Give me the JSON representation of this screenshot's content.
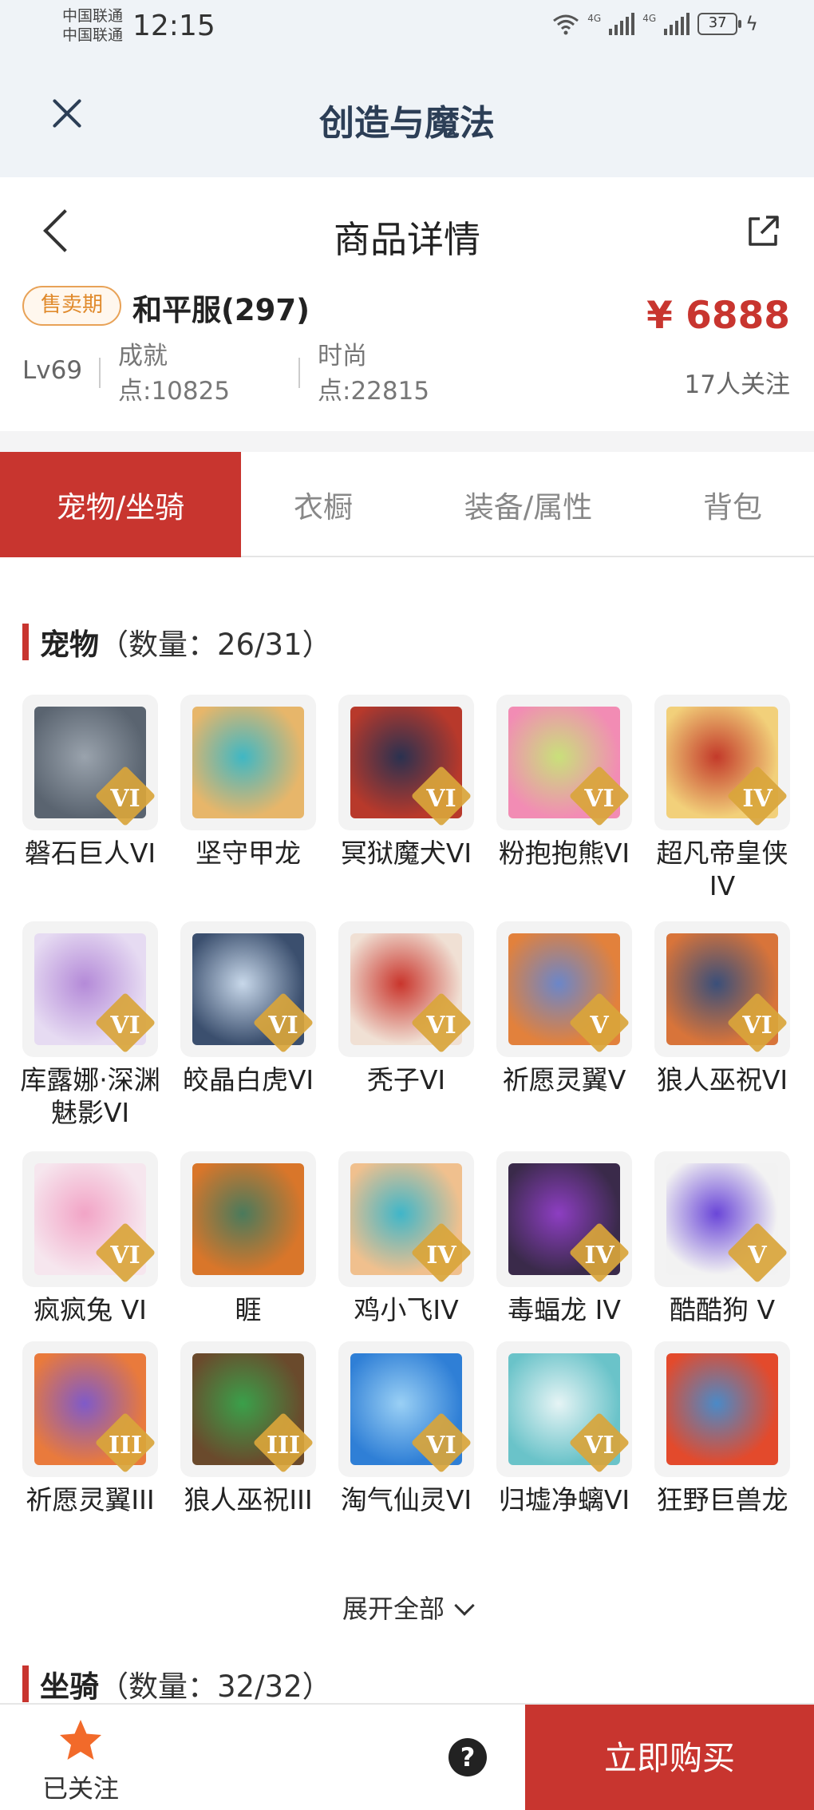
{
  "status_bar": {
    "carrier1": "中国联通",
    "carrier2": "中国联通",
    "time": "12:15",
    "net1": "4G",
    "net2": "4G",
    "battery": "37"
  },
  "app_bar": {
    "title": "创造与魔法"
  },
  "header": {
    "title": "商品详情"
  },
  "product": {
    "badge": "售卖期",
    "server": "和平服(297)",
    "price": "¥ 6888",
    "level": "Lv69",
    "achievement_label": "成就",
    "achievement_value": "点:10825",
    "fashion_label": "时尚",
    "fashion_value": "点:22815",
    "followers": "17人关注"
  },
  "tabs": [
    "宠物/坐骑",
    "衣橱",
    "装备/属性",
    "背包"
  ],
  "active_tab": 0,
  "pets_section": {
    "name": "宠物",
    "count": "（数量：26/31）"
  },
  "pets": [
    {
      "name": "磐石巨人VI",
      "grade": "VI"
    },
    {
      "name": "坚守甲龙",
      "grade": ""
    },
    {
      "name": "冥狱魔犬VI",
      "grade": "VI"
    },
    {
      "name": "粉抱抱熊VI",
      "grade": "VI"
    },
    {
      "name": "超凡帝皇侠IV",
      "grade": "IV"
    },
    {
      "name": "库露娜·深渊魅影VI",
      "grade": "VI"
    },
    {
      "name": "皎晶白虎VI",
      "grade": "VI"
    },
    {
      "name": "秃子VI",
      "grade": "VI"
    },
    {
      "name": "祈愿灵翼V",
      "grade": "V"
    },
    {
      "name": "狼人巫祝VI",
      "grade": "VI"
    },
    {
      "name": "疯疯兔 VI",
      "grade": "VI"
    },
    {
      "name": "睚",
      "grade": ""
    },
    {
      "name": "鸡小飞IV",
      "grade": "IV"
    },
    {
      "name": "毒蝠龙 IV",
      "grade": "IV"
    },
    {
      "name": "酷酷狗 V",
      "grade": "V"
    },
    {
      "name": "祈愿灵翼III",
      "grade": "III"
    },
    {
      "name": "狼人巫祝III",
      "grade": "III"
    },
    {
      "name": "淘气仙灵VI",
      "grade": "VI"
    },
    {
      "name": "归墟净螭VI",
      "grade": "VI"
    },
    {
      "name": "狂野巨兽龙",
      "grade": ""
    }
  ],
  "expand_label": "展开全部",
  "mounts_section": {
    "name": "坐骑",
    "count": "（数量：32/32）"
  },
  "bottom": {
    "favorite_label": "已关注",
    "help": "?",
    "buy_label": "立即购买"
  },
  "colors": {
    "accent": "#c8352f",
    "badge": "#e08a2c",
    "grade": "#d9a53b",
    "favorite_star": "#f26a2a"
  },
  "icons": {
    "close": "close-icon",
    "back": "chevron-left-icon",
    "share": "share-icon",
    "favorite": "star-icon",
    "help": "question-icon",
    "expand": "chevron-down-icon"
  }
}
